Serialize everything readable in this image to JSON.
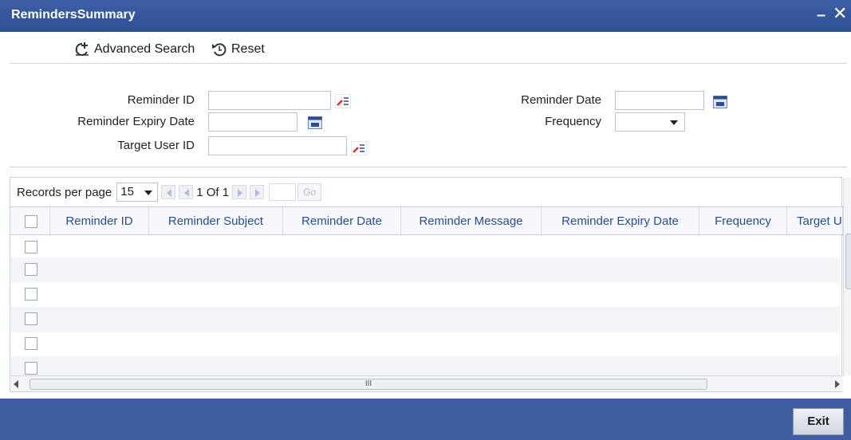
{
  "window": {
    "title": "RemindersSummary",
    "minimize": "–",
    "close": "✕"
  },
  "toolbar": {
    "advanced_search_label": "Advanced Search",
    "reset_label": "Reset"
  },
  "search": {
    "reminder_id_label": "Reminder ID",
    "reminder_expiry_date_label": "Reminder Expiry Date",
    "target_user_id_label": "Target User ID",
    "reminder_date_label": "Reminder Date",
    "frequency_label": "Frequency",
    "reminder_id_value": "",
    "reminder_expiry_date_value": "",
    "target_user_id_value": "",
    "reminder_date_value": "",
    "frequency_value": ""
  },
  "pager": {
    "records_per_page_label": "Records per page",
    "records_per_page_value": "15",
    "page_info": "1 Of 1",
    "go_label": "Go"
  },
  "grid": {
    "columns": [
      "Reminder ID",
      "Reminder Subject",
      "Reminder Date",
      "Reminder Message",
      "Reminder Expiry Date",
      "Frequency",
      "Target U"
    ],
    "row_count": 6,
    "hscroll_grip": "III"
  },
  "footer": {
    "exit_label": "Exit"
  },
  "colors": {
    "titlebar": "#2f4f93",
    "footer": "#3f5ea1",
    "header_text": "#2a4c8f"
  }
}
